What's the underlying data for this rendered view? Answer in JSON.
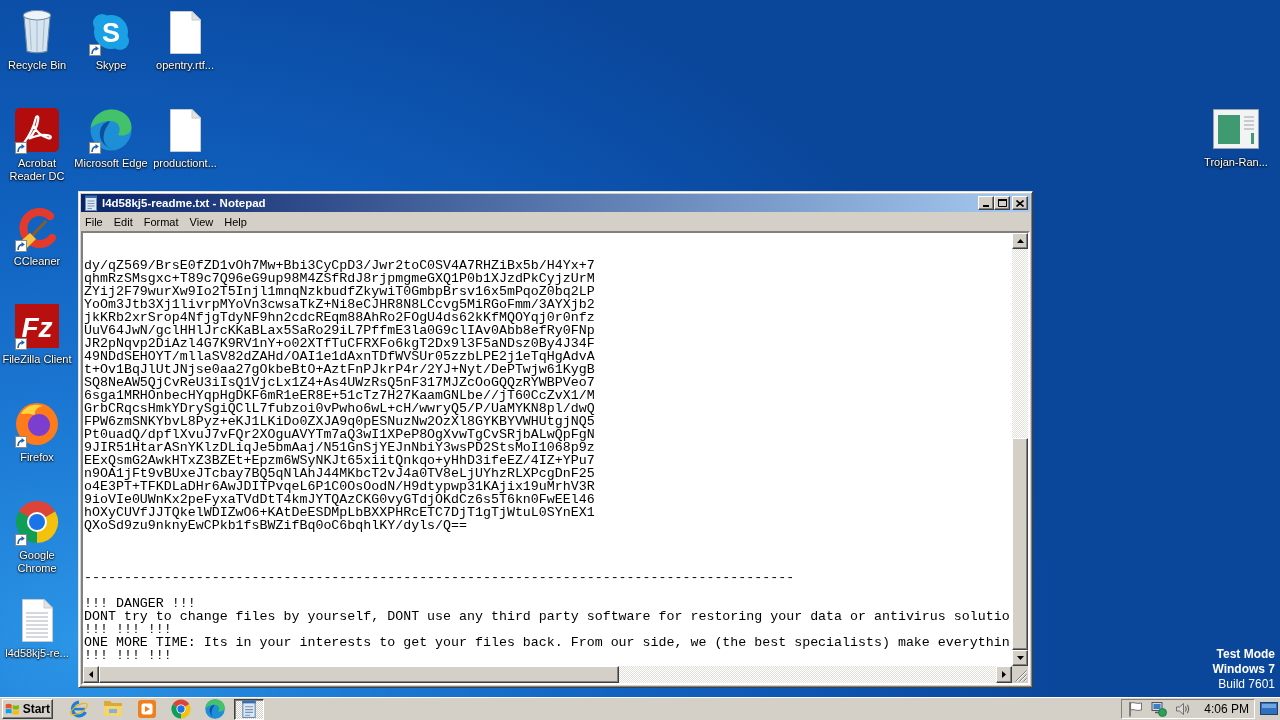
{
  "desktop": {
    "icon_columns": [
      [
        {
          "label": "Recycle Bin",
          "kind": "bin",
          "shortcut": false
        },
        {
          "label": "Acrobat Reader DC",
          "kind": "acrobat",
          "shortcut": true
        },
        {
          "label": "CCleaner",
          "kind": "ccleaner",
          "shortcut": true
        },
        {
          "label": "FileZilla Client",
          "kind": "filezilla",
          "shortcut": true,
          "logo_text": "Fz"
        },
        {
          "label": "Firefox",
          "kind": "firefox",
          "shortcut": true
        },
        {
          "label": "Google Chrome",
          "kind": "chrome",
          "shortcut": true
        },
        {
          "label": "l4d58kj5-re...",
          "kind": "textfile",
          "shortcut": false
        }
      ],
      [
        {
          "label": "Skype",
          "kind": "skype",
          "shortcut": true,
          "logo_text": "S"
        },
        {
          "label": "Microsoft Edge",
          "kind": "edge",
          "shortcut": true
        }
      ],
      [
        {
          "label": "opentry.rtf...",
          "kind": "document",
          "shortcut": false
        },
        {
          "label": "productiont...",
          "kind": "document",
          "shortcut": false
        }
      ]
    ],
    "icons_right": [
      {
        "label": "Trojan-Ran...",
        "kind": "app",
        "shortcut": false
      }
    ]
  },
  "window": {
    "title": "l4d58kj5-readme.txt - Notepad",
    "menu": [
      "File",
      "Edit",
      "Format",
      "View",
      "Help"
    ],
    "blocks": [
      {
        "kind": "key",
        "lines": [
          "dy/qZ569/BrsE0fZD1vOh7Mw+Bbi3CyCpD3/Jwr2toC0SV4A7RHZiBx5b/H4Yx+7",
          "qhmRzSMsgxc+T89c7Q96eG9up98M4ZSfRdJ8rjpmgmeGXQ1P0b1XJzdPkCyjzUrM",
          "ZYij2F79wurXw9Io2T5Injl1mnqNzkbudfZkywiT0GmbpBrsv16x5mPqoZ0bq2LP",
          "YoOm3Jtb3Xj1livrpMYoVn3cwsaTkZ+Ni8eCJHR8N8LCcvg5MiRGoFmm/3AYXjb2",
          "jkKRb2xrSrop4NfjgTdyNF9hn2cdcREqm88AhRo2FOgU4ds62kKfMQOYqj0r0nfz",
          "UuV64JwN/gclHHlJrcKKaBLax5SaRo29iL7PffmE3la0G9clIAv0Abb8efRy0FNp",
          "JR2pNqvp2DiAzl4G7K9RV1nY+o02XTfTuCFRXFo6kgT2Dx9l3F5aNDsz0By4J34F",
          "49NDdSEHOYT/mllaSV82dZAHd/OAI1e1dAxnTDfWVSUr05zzbLPE2j1eTqHgAdvA",
          "t+Ov1BqJlUtJNjse0aa27gOkbeBtO+AztFnPJkrP4r/2YJ+Nyt/DePTwjw61KygB",
          "SQ8NeAW5QjCvReU3iIsQ1VjcLx1Z4+As4UWzRsQ5nF317MJZcOoGQQzRYWBPVeo7",
          "6sga1MRHOnbecHYqpHgDKF6mR1eER8E+51cTz7H27KaamGNLbe//jT60CcZvX1/M",
          "GrbCRqcsHmkYDrySgiQClL7fubzoi0vPwho6wL+cH/wwryQ5/P/UaMYKN8pl/dwQ",
          "FPW6zmSNKYbvL8Pyz+eKJ1LKiDo0ZXJA9q0pESNuzNw2OzXl8GYKBYVWHUtgjNQ5",
          "Pt0uadQ/dpflXvuJ7vFQr2XOguAVYTm7aQ3wI1XPeP8OgXvwTgCvSRjbALwQpFgN",
          "9JIR51HtarASnYKlzDLiqJe5bmAaj/N51GnSjYEJnNbiY3wsPD2StsMoI1068p9z",
          "EExQsmG2AwkHTxZ3BZEt+Epzm6WSyNKJt65xiitQnkqo+yHhD3ifeEZ/4IZ+YPu7",
          "n9OA1jFt9vBUxeJTcbay7BQ5qNlAhJ44MKbcT2vJ4a0TV8eLjUYhzRLXPcgDnF25",
          "o4E3PT+TFKDLaDHr6AwJDITPvqeL6P1C0OsOodN/H9dtypwp31KAjix19uMrhV3R",
          "9ioVIe0UWnKx2peFyxaTVdDtT4kmJYTQAzCKG0vyGTdjOKdCz6s5T6kn0FwEEl46",
          "hOXyCUVfJJTQkelWDIZwO6+KAtDeESDMpLbBXXPHRcETC7DjT1gTjWtuL0SYnEX1",
          "QXoSd9zu9nknyEwCPkb1fsBWZifBq0oC6bqhlKY/dyls/Q=="
        ]
      },
      {
        "kind": "separator",
        "lines": [
          "-----------------------------------------------------------------------------------------"
        ]
      },
      {
        "kind": "notice",
        "lines": [
          "!!! DANGER !!!",
          "DONT try to change files by yourself, DONT use any third party software for restoring your data or antivirus solutio",
          "!!! !!! !!!",
          "ONE MORE TIME: Its in your interests to get your files back. From our side, we (the best specialists) make everythin",
          "!!! !!! !!!"
        ]
      }
    ]
  },
  "test_mode": [
    {
      "text": "Test Mode",
      "bold": true
    },
    {
      "text": "Windows 7",
      "bold": true
    },
    {
      "text": "Build 7601",
      "bold": false
    }
  ],
  "taskbar": {
    "start": "Start",
    "quick_launch": [
      {
        "kind": "ie"
      },
      {
        "kind": "folder"
      },
      {
        "kind": "media"
      },
      {
        "kind": "chrome"
      },
      {
        "kind": "edge"
      }
    ],
    "tasks": [
      {
        "kind": "notepad",
        "selected": true
      }
    ],
    "tray": [
      {
        "kind": "flag"
      },
      {
        "kind": "network"
      },
      {
        "kind": "volume"
      }
    ],
    "clock": "4:06 PM"
  }
}
